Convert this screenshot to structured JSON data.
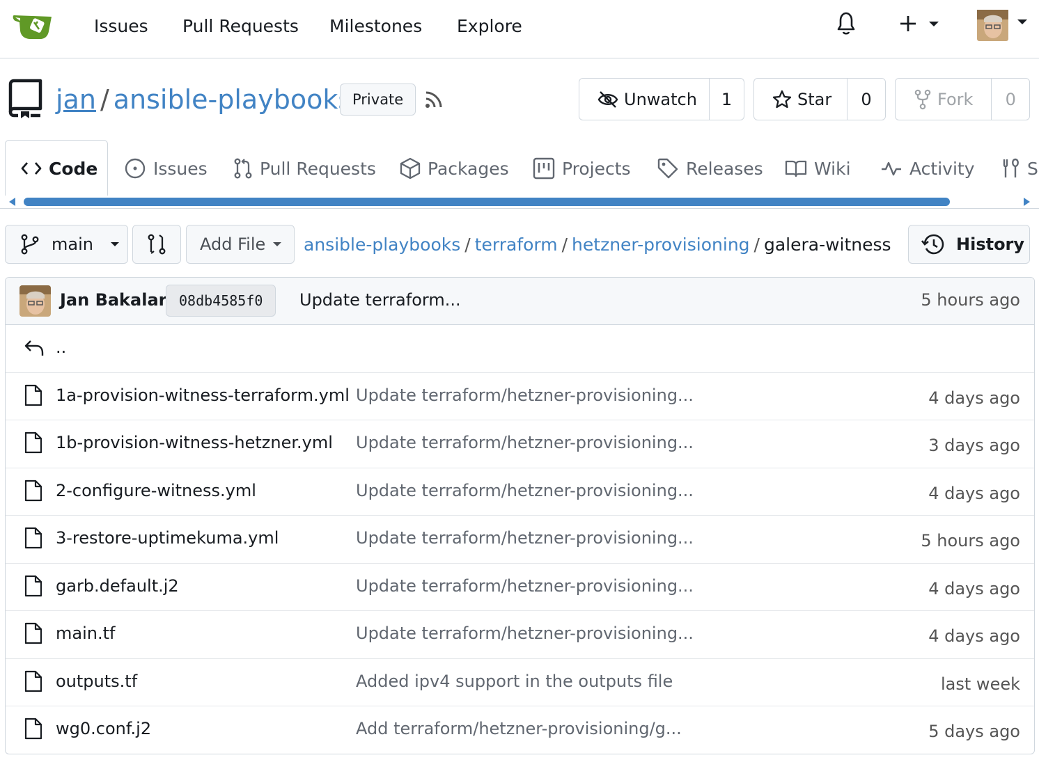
{
  "nav": {
    "links": [
      "Issues",
      "Pull Requests",
      "Milestones",
      "Explore"
    ]
  },
  "repo": {
    "owner": "jan",
    "separator": "/",
    "name": "ansible-playbooks",
    "visibility": "Private",
    "watch": {
      "label": "Unwatch",
      "count": "1"
    },
    "star": {
      "label": "Star",
      "count": "0"
    },
    "fork": {
      "label": "Fork",
      "count": "0"
    }
  },
  "tabs": [
    {
      "label": "Code",
      "icon": "code-icon",
      "active": true
    },
    {
      "label": "Issues",
      "icon": "issue-icon"
    },
    {
      "label": "Pull Requests",
      "icon": "pull-request-icon"
    },
    {
      "label": "Packages",
      "icon": "package-icon"
    },
    {
      "label": "Projects",
      "icon": "project-icon"
    },
    {
      "label": "Releases",
      "icon": "tag-icon"
    },
    {
      "label": "Wiki",
      "icon": "book-icon"
    },
    {
      "label": "Activity",
      "icon": "pulse-icon"
    },
    {
      "label": "S",
      "icon": "tools-icon"
    }
  ],
  "toolbar": {
    "branch": "main",
    "add_file": "Add File",
    "history": "History"
  },
  "breadcrumb": {
    "parts": [
      "ansible-playbooks",
      "terraform",
      "hetzner-provisioning"
    ],
    "current": "galera-witness",
    "sep": "/"
  },
  "latest_commit": {
    "author": "Jan Bakalar",
    "sha": "08db4585f0",
    "message": "Update terraform...",
    "time": "5 hours ago"
  },
  "parent_dir": "..",
  "files": [
    {
      "name": "1a-provision-witness-terraform.yml",
      "message": "Update terraform/hetzner-provisioning...",
      "time": "4 days ago"
    },
    {
      "name": "1b-provision-witness-hetzner.yml",
      "message": "Update terraform/hetzner-provisioning...",
      "time": "3 days ago"
    },
    {
      "name": "2-configure-witness.yml",
      "message": "Update terraform/hetzner-provisioning...",
      "time": "4 days ago"
    },
    {
      "name": "3-restore-uptimekuma.yml",
      "message": "Update terraform/hetzner-provisioning...",
      "time": "5 hours ago"
    },
    {
      "name": "garb.default.j2",
      "message": "Update terraform/hetzner-provisioning...",
      "time": "4 days ago"
    },
    {
      "name": "main.tf",
      "message": "Update terraform/hetzner-provisioning...",
      "time": "4 days ago"
    },
    {
      "name": "outputs.tf",
      "message": "Added ipv4 support in the outputs file",
      "time": "last week"
    },
    {
      "name": "wg0.conf.j2",
      "message": "Add terraform/hetzner-provisioning/g...",
      "time": "5 days ago"
    }
  ],
  "colors": {
    "link": "#4183c4",
    "logo_green": "#609926",
    "border": "#d0d7de"
  }
}
